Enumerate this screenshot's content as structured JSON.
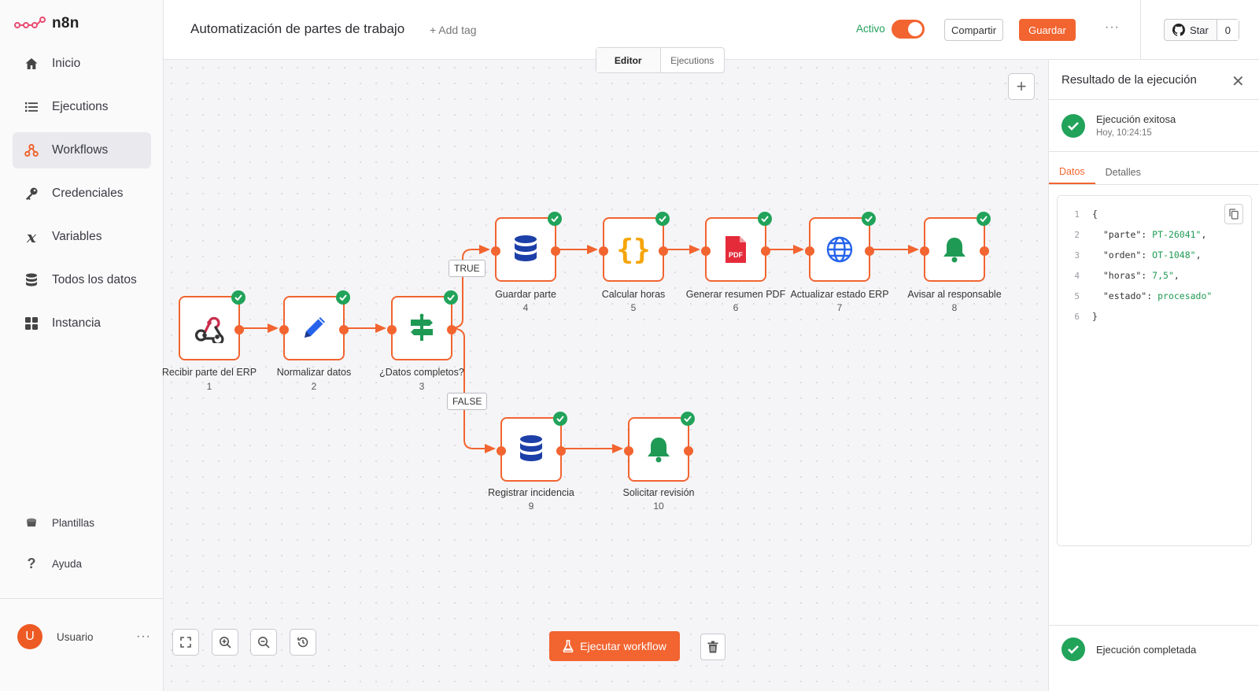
{
  "app": {
    "logo_text": "n8n"
  },
  "sidebar": {
    "items": [
      {
        "label": "Inicio",
        "icon": "home-icon"
      },
      {
        "label": "Ejecutions",
        "icon": "list-icon"
      },
      {
        "label": "Workflows",
        "icon": "workflow-icon",
        "active": true
      },
      {
        "label": "Credenciales",
        "icon": "key-icon"
      },
      {
        "label": "Variables",
        "icon": "variable-icon"
      },
      {
        "label": "Todos los datos",
        "icon": "database-icon"
      },
      {
        "label": "Instancia",
        "icon": "grid-icon"
      }
    ],
    "bottom": [
      {
        "label": "Plantillas",
        "icon": "templates-icon"
      },
      {
        "label": "Ayuda",
        "icon": "help-icon"
      }
    ],
    "user": {
      "initial": "U",
      "name": "Usuario",
      "more": "···"
    }
  },
  "header": {
    "title": "Automatización de partes de trabajo",
    "add_tag": "+ Add tag",
    "active_label": "Activo",
    "share_label": "Compartir",
    "save_label": "Guardar",
    "more": "···",
    "github_star": "Star",
    "github_count": "0",
    "tabs": [
      "Editor",
      "Ejecutions"
    ]
  },
  "workflow": {
    "nodes": [
      {
        "label": "Recibir parte del ERP",
        "num": "1",
        "icon": "webhook-icon"
      },
      {
        "label": "Normalizar datos",
        "num": "2",
        "icon": "pencil-icon"
      },
      {
        "label": "¿Datos completos?",
        "num": "3",
        "icon": "if-signpost-icon"
      },
      {
        "label": "Guardar parte",
        "num": "4",
        "icon": "database-icon"
      },
      {
        "label": "Calcular horas",
        "num": "5",
        "icon": "code-braces-icon"
      },
      {
        "label": "Generar resumen PDF",
        "num": "6",
        "icon": "pdf-icon"
      },
      {
        "label": "Actualizar estado ERP",
        "num": "7",
        "icon": "globe-icon"
      },
      {
        "label": "Avisar al responsable",
        "num": "8",
        "icon": "bell-icon"
      },
      {
        "label": "Registrar incidencia",
        "num": "9",
        "icon": "database-icon"
      },
      {
        "label": "Solicitar revisión",
        "num": "10",
        "icon": "bell-icon"
      }
    ],
    "branch_true": "TRUE",
    "branch_false": "FALSE",
    "run_label": "Ejecutar workflow"
  },
  "panel": {
    "title": "Resultado de la ejecución",
    "status": "Ejecución exitosa",
    "time": "Hoy, 10:24:15",
    "tabs": [
      "Datos",
      "Detalles"
    ],
    "code": [
      {
        "n": "1",
        "key": "{",
        "val": ""
      },
      {
        "n": "2",
        "key": "  \"parte\": ",
        "val": "PT-26041\"",
        "end": ","
      },
      {
        "n": "3",
        "key": "  \"orden\": ",
        "val": "OT-1048\"",
        "end": ","
      },
      {
        "n": "4",
        "key": "  \"horas\": ",
        "val": "7,5\"",
        "end": ","
      },
      {
        "n": "5",
        "key": "  \"estado\": ",
        "val": "procesado\"",
        "end": ""
      },
      {
        "n": "6",
        "key": "}",
        "val": ""
      }
    ],
    "footer": "Ejecución completada"
  },
  "colors": {
    "accent": "#f26430",
    "success": "#21a35a",
    "db": "#1d3fa8"
  }
}
